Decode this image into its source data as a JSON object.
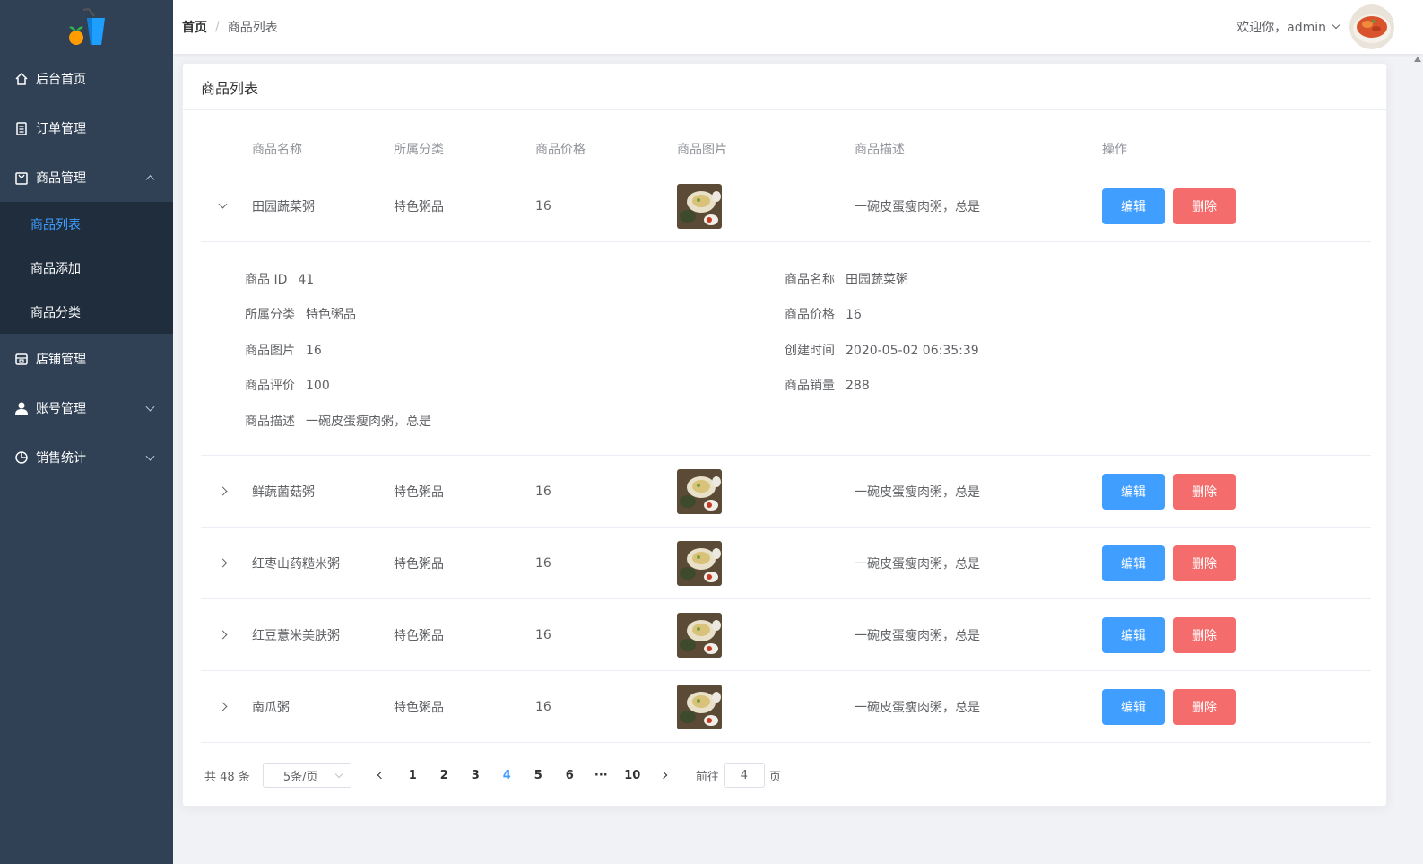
{
  "header": {
    "breadcrumb_home": "首页",
    "breadcrumb_sep": "/",
    "breadcrumb_current": "商品列表",
    "welcome": "欢迎你，admin"
  },
  "sidebar": {
    "items": [
      {
        "label": "后台首页",
        "icon": "home-icon"
      },
      {
        "label": "订单管理",
        "icon": "clipboard-icon"
      },
      {
        "label": "商品管理",
        "icon": "bag-icon",
        "expanded": true,
        "children": [
          {
            "label": "商品列表",
            "active": true
          },
          {
            "label": "商品添加"
          },
          {
            "label": "商品分类"
          }
        ]
      },
      {
        "label": "店铺管理",
        "icon": "store-icon"
      },
      {
        "label": "账号管理",
        "icon": "user-icon"
      },
      {
        "label": "销售统计",
        "icon": "pie-chart-icon"
      }
    ]
  },
  "card": {
    "title": "商品列表"
  },
  "table": {
    "columns": [
      "商品名称",
      "所属分类",
      "商品价格",
      "商品图片",
      "商品描述",
      "操作"
    ],
    "edit_label": "编辑",
    "delete_label": "删除",
    "rows": [
      {
        "name": "田园蔬菜粥",
        "category": "特色粥品",
        "price": "16",
        "desc": "一碗皮蛋瘦肉粥，总是",
        "expanded": true
      },
      {
        "name": "鲜蔬菌菇粥",
        "category": "特色粥品",
        "price": "16",
        "desc": "一碗皮蛋瘦肉粥，总是"
      },
      {
        "name": "红枣山药糙米粥",
        "category": "特色粥品",
        "price": "16",
        "desc": "一碗皮蛋瘦肉粥，总是"
      },
      {
        "name": "红豆薏米美肤粥",
        "category": "特色粥品",
        "price": "16",
        "desc": "一碗皮蛋瘦肉粥，总是"
      },
      {
        "name": "南瓜粥",
        "category": "特色粥品",
        "price": "16",
        "desc": "一碗皮蛋瘦肉粥，总是"
      }
    ],
    "detail": {
      "id_label": "商品 ID",
      "id_value": "41",
      "name_label": "商品名称",
      "name_value": "田园蔬菜粥",
      "category_label": "所属分类",
      "category_value": "特色粥品",
      "price_label": "商品价格",
      "price_value": "16",
      "image_label": "商品图片",
      "image_value": "16",
      "created_label": "创建时间",
      "created_value": "2020-05-02 06:35:39",
      "rating_label": "商品评价",
      "rating_value": "100",
      "sales_label": "商品销量",
      "sales_value": "288",
      "desc_label": "商品描述",
      "desc_value": "一碗皮蛋瘦肉粥，总是"
    }
  },
  "pagination": {
    "total": "共 48 条",
    "page_size": "5条/页",
    "pages": [
      "1",
      "2",
      "3",
      "4",
      "5",
      "6",
      "···",
      "10"
    ],
    "current": "4",
    "goto_label": "前往",
    "goto_value": "4",
    "page_suffix": "页"
  },
  "colors": {
    "sidebar": "#304156",
    "submenu": "#1f2d3d",
    "primary": "#409eff",
    "danger": "#f56c6c"
  }
}
